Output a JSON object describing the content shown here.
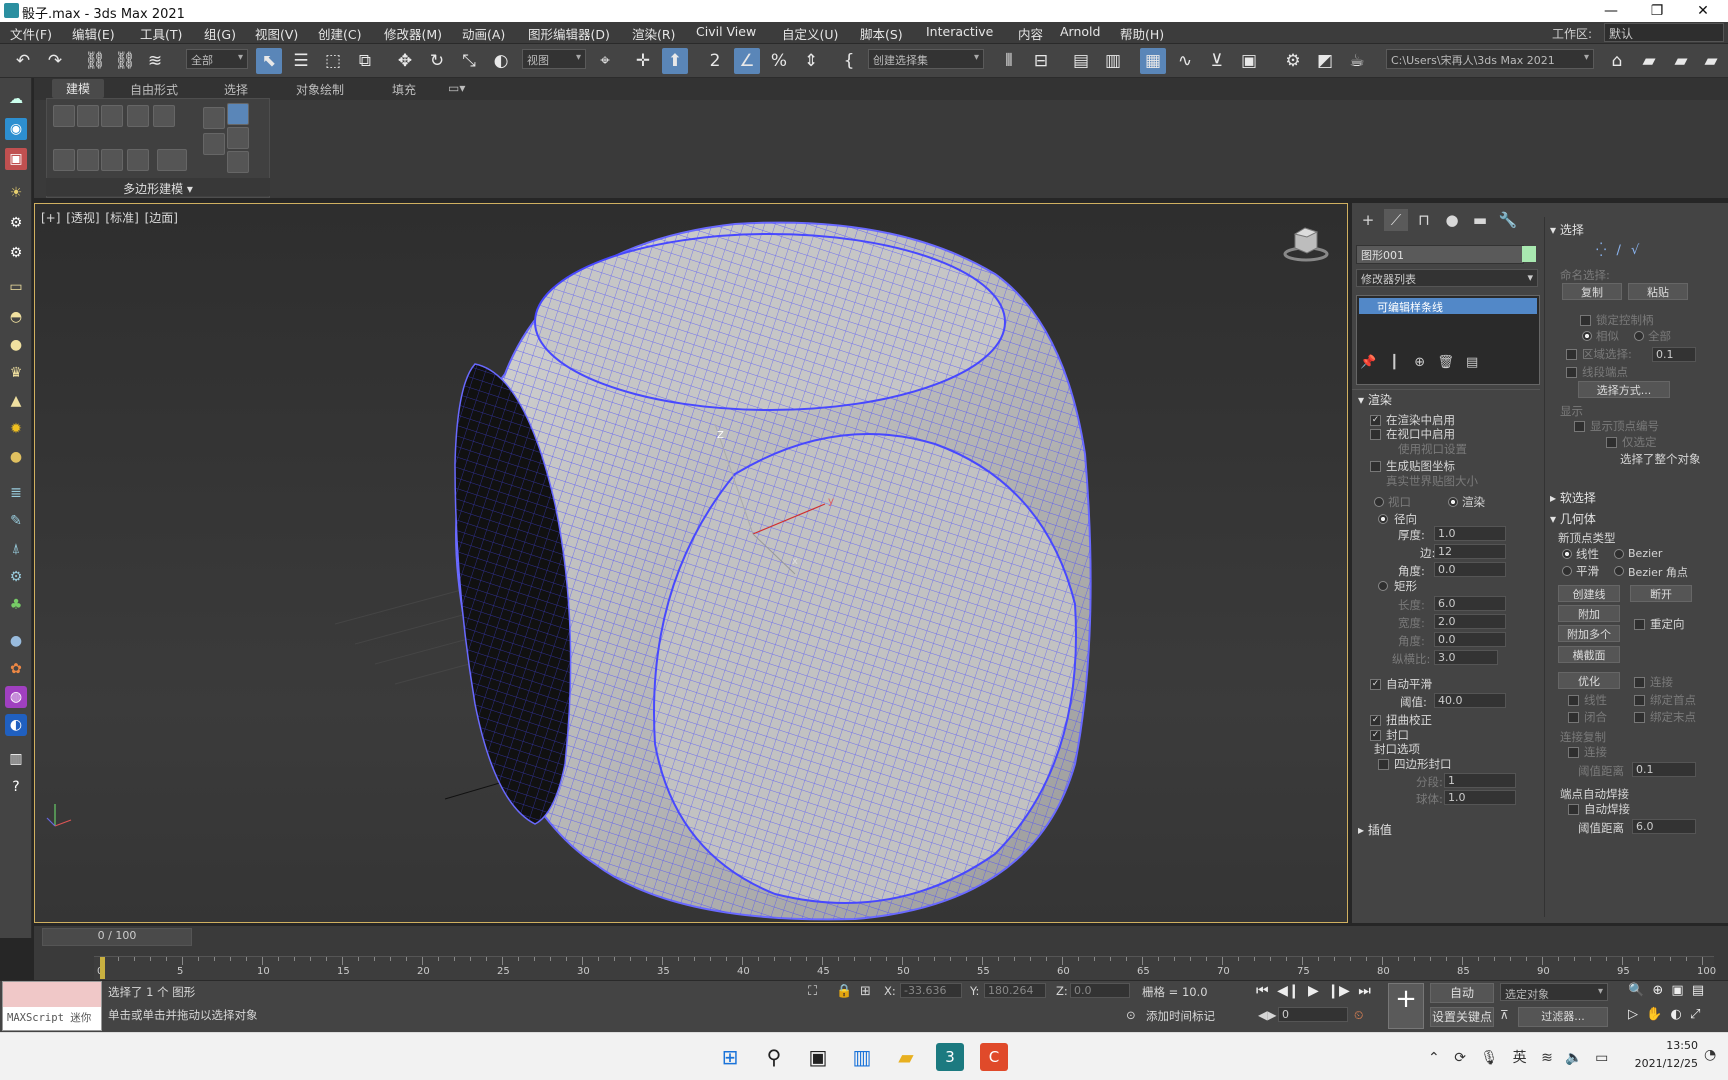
{
  "window": {
    "title": "骰子.max - 3ds Max 2021",
    "min": "—",
    "max": "❐",
    "close": "✕"
  },
  "menu": [
    "文件(F)",
    "编辑(E)",
    "工具(T)",
    "组(G)",
    "视图(V)",
    "创建(C)",
    "修改器(M)",
    "动画(A)",
    "图形编辑器(D)",
    "渲染(R)",
    "Civil View",
    "自定义(U)",
    "脚本(S)",
    "Interactive",
    "内容",
    "Arnold",
    "帮助(H)"
  ],
  "workspace": {
    "label": "工作区:",
    "value": "默认"
  },
  "toolbar": {
    "filter": "全部",
    "coord": "视图",
    "selset": "创建选择集",
    "path": "C:\\Users\\宋再人\\3ds Max 2021"
  },
  "ribbon": {
    "tabs": [
      "建模",
      "自由形式",
      "选择",
      "对象绘制",
      "填充"
    ],
    "panel_title": "多边形建模"
  },
  "viewport": {
    "label": "[+] [透视] [标准] [边面]"
  },
  "cmd": {
    "object_name": "图形001",
    "object_color": "#a8e8b0",
    "modifier_list": "修改器列表",
    "stack_item": "可编辑样条线",
    "rendering": {
      "title": "渲染",
      "enable_render": "在渲染中启用",
      "enable_viewport": "在视口中启用",
      "use_viewport_settings": "使用视口设置",
      "gen_map_coords": "生成贴图坐标",
      "real_world": "真实世界贴图大小",
      "viewport": "视口",
      "render": "渲染",
      "radial": "径向",
      "thickness_l": "厚度:",
      "thickness": "1.0",
      "sides_l": "边:",
      "sides": "12",
      "angle_l": "角度:",
      "angle": "0.0",
      "rect": "矩形",
      "length_l": "长度:",
      "length": "6.0",
      "width_l": "宽度:",
      "width": "2.0",
      "angle2_l": "角度:",
      "angle2": "0.0",
      "aspect_l": "纵横比:",
      "aspect": "3.0",
      "auto_smooth": "自动平滑",
      "threshold_l": "阈值:",
      "threshold": "40.0",
      "twist": "扭曲校正",
      "cap": "封口",
      "cap_options": "封口选项",
      "quad_cap": "四边形封口",
      "segs_l": "分段:",
      "segs": "1",
      "sphere_l": "球体:",
      "sphere": "1.0"
    },
    "interp": "插值",
    "selection": {
      "title": "选择",
      "named_sel": "命名选择:",
      "copy": "复制",
      "paste": "粘贴",
      "lock_handles": "锁定控制柄",
      "alike": "相似",
      "all": "全部",
      "area_sel": "区域选择:",
      "area_val": "0.1",
      "seg_end": "线段端点",
      "sel_by": "选择方式...",
      "display": "显示",
      "show_vnum": "显示顶点编号",
      "sel_only": "仅选定",
      "status": "选择了整个对象"
    },
    "soft_sel": "软选择",
    "geometry": {
      "title": "几何体",
      "new_vtype": "新顶点类型",
      "linear": "线性",
      "bezier": "Bezier",
      "smooth": "平滑",
      "bezier_corner": "Bezier 角点",
      "create_line": "创建线",
      "break": "断开",
      "attach": "附加",
      "reorient": "重定向",
      "attach_mult": "附加多个",
      "cross_section": "横截面",
      "refine": "优化",
      "connect": "连接",
      "linear2": "线性",
      "bind_first": "绑定首点",
      "closed": "闭合",
      "bind_last": "绑定末点",
      "conn_copy": "连接复制",
      "connect2": "连接",
      "thresh_dist": "阈值距离",
      "thresh_val": "0.1",
      "end_weld": "端点自动焊接",
      "auto_weld": "自动焊接",
      "thresh_dist2": "阈值距离",
      "thresh_val2": "6.0"
    }
  },
  "timeline": {
    "slider": "0 / 100",
    "ticks": [
      "0",
      "5",
      "10",
      "15",
      "20",
      "25",
      "30",
      "35",
      "40",
      "45",
      "50",
      "55",
      "60",
      "65",
      "70",
      "75",
      "80",
      "85",
      "90",
      "95",
      "100"
    ]
  },
  "status": {
    "maxscript": "MAXScript 迷你",
    "line1": "选择了 1 个 图形",
    "line2": "单击或单击并拖动以选择对象",
    "x_l": "X:",
    "x": "-33.636",
    "y_l": "Y:",
    "y": "180.264",
    "z_l": "Z:",
    "z": "0.0",
    "grid": "栅格 = 10.0",
    "add_time_tag": "添加时间标记",
    "auto": "自动",
    "set_key": "设置关键点",
    "sel_obj": "选定对象",
    "filters": "过滤器...",
    "frame": "0"
  },
  "taskbar": {
    "lang": "英",
    "time": "13:50",
    "date": "2021/12/25"
  }
}
